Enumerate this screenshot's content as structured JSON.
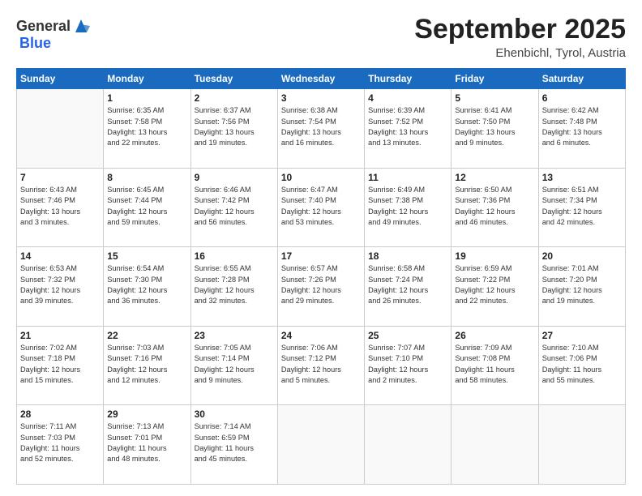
{
  "header": {
    "logo_general": "General",
    "logo_blue": "Blue",
    "month": "September 2025",
    "location": "Ehenbichl, Tyrol, Austria"
  },
  "days_of_week": [
    "Sunday",
    "Monday",
    "Tuesday",
    "Wednesday",
    "Thursday",
    "Friday",
    "Saturday"
  ],
  "weeks": [
    [
      {
        "day": "",
        "info": ""
      },
      {
        "day": "1",
        "info": "Sunrise: 6:35 AM\nSunset: 7:58 PM\nDaylight: 13 hours\nand 22 minutes."
      },
      {
        "day": "2",
        "info": "Sunrise: 6:37 AM\nSunset: 7:56 PM\nDaylight: 13 hours\nand 19 minutes."
      },
      {
        "day": "3",
        "info": "Sunrise: 6:38 AM\nSunset: 7:54 PM\nDaylight: 13 hours\nand 16 minutes."
      },
      {
        "day": "4",
        "info": "Sunrise: 6:39 AM\nSunset: 7:52 PM\nDaylight: 13 hours\nand 13 minutes."
      },
      {
        "day": "5",
        "info": "Sunrise: 6:41 AM\nSunset: 7:50 PM\nDaylight: 13 hours\nand 9 minutes."
      },
      {
        "day": "6",
        "info": "Sunrise: 6:42 AM\nSunset: 7:48 PM\nDaylight: 13 hours\nand 6 minutes."
      }
    ],
    [
      {
        "day": "7",
        "info": "Sunrise: 6:43 AM\nSunset: 7:46 PM\nDaylight: 13 hours\nand 3 minutes."
      },
      {
        "day": "8",
        "info": "Sunrise: 6:45 AM\nSunset: 7:44 PM\nDaylight: 12 hours\nand 59 minutes."
      },
      {
        "day": "9",
        "info": "Sunrise: 6:46 AM\nSunset: 7:42 PM\nDaylight: 12 hours\nand 56 minutes."
      },
      {
        "day": "10",
        "info": "Sunrise: 6:47 AM\nSunset: 7:40 PM\nDaylight: 12 hours\nand 53 minutes."
      },
      {
        "day": "11",
        "info": "Sunrise: 6:49 AM\nSunset: 7:38 PM\nDaylight: 12 hours\nand 49 minutes."
      },
      {
        "day": "12",
        "info": "Sunrise: 6:50 AM\nSunset: 7:36 PM\nDaylight: 12 hours\nand 46 minutes."
      },
      {
        "day": "13",
        "info": "Sunrise: 6:51 AM\nSunset: 7:34 PM\nDaylight: 12 hours\nand 42 minutes."
      }
    ],
    [
      {
        "day": "14",
        "info": "Sunrise: 6:53 AM\nSunset: 7:32 PM\nDaylight: 12 hours\nand 39 minutes."
      },
      {
        "day": "15",
        "info": "Sunrise: 6:54 AM\nSunset: 7:30 PM\nDaylight: 12 hours\nand 36 minutes."
      },
      {
        "day": "16",
        "info": "Sunrise: 6:55 AM\nSunset: 7:28 PM\nDaylight: 12 hours\nand 32 minutes."
      },
      {
        "day": "17",
        "info": "Sunrise: 6:57 AM\nSunset: 7:26 PM\nDaylight: 12 hours\nand 29 minutes."
      },
      {
        "day": "18",
        "info": "Sunrise: 6:58 AM\nSunset: 7:24 PM\nDaylight: 12 hours\nand 26 minutes."
      },
      {
        "day": "19",
        "info": "Sunrise: 6:59 AM\nSunset: 7:22 PM\nDaylight: 12 hours\nand 22 minutes."
      },
      {
        "day": "20",
        "info": "Sunrise: 7:01 AM\nSunset: 7:20 PM\nDaylight: 12 hours\nand 19 minutes."
      }
    ],
    [
      {
        "day": "21",
        "info": "Sunrise: 7:02 AM\nSunset: 7:18 PM\nDaylight: 12 hours\nand 15 minutes."
      },
      {
        "day": "22",
        "info": "Sunrise: 7:03 AM\nSunset: 7:16 PM\nDaylight: 12 hours\nand 12 minutes."
      },
      {
        "day": "23",
        "info": "Sunrise: 7:05 AM\nSunset: 7:14 PM\nDaylight: 12 hours\nand 9 minutes."
      },
      {
        "day": "24",
        "info": "Sunrise: 7:06 AM\nSunset: 7:12 PM\nDaylight: 12 hours\nand 5 minutes."
      },
      {
        "day": "25",
        "info": "Sunrise: 7:07 AM\nSunset: 7:10 PM\nDaylight: 12 hours\nand 2 minutes."
      },
      {
        "day": "26",
        "info": "Sunrise: 7:09 AM\nSunset: 7:08 PM\nDaylight: 11 hours\nand 58 minutes."
      },
      {
        "day": "27",
        "info": "Sunrise: 7:10 AM\nSunset: 7:06 PM\nDaylight: 11 hours\nand 55 minutes."
      }
    ],
    [
      {
        "day": "28",
        "info": "Sunrise: 7:11 AM\nSunset: 7:03 PM\nDaylight: 11 hours\nand 52 minutes."
      },
      {
        "day": "29",
        "info": "Sunrise: 7:13 AM\nSunset: 7:01 PM\nDaylight: 11 hours\nand 48 minutes."
      },
      {
        "day": "30",
        "info": "Sunrise: 7:14 AM\nSunset: 6:59 PM\nDaylight: 11 hours\nand 45 minutes."
      },
      {
        "day": "",
        "info": ""
      },
      {
        "day": "",
        "info": ""
      },
      {
        "day": "",
        "info": ""
      },
      {
        "day": "",
        "info": ""
      }
    ]
  ]
}
